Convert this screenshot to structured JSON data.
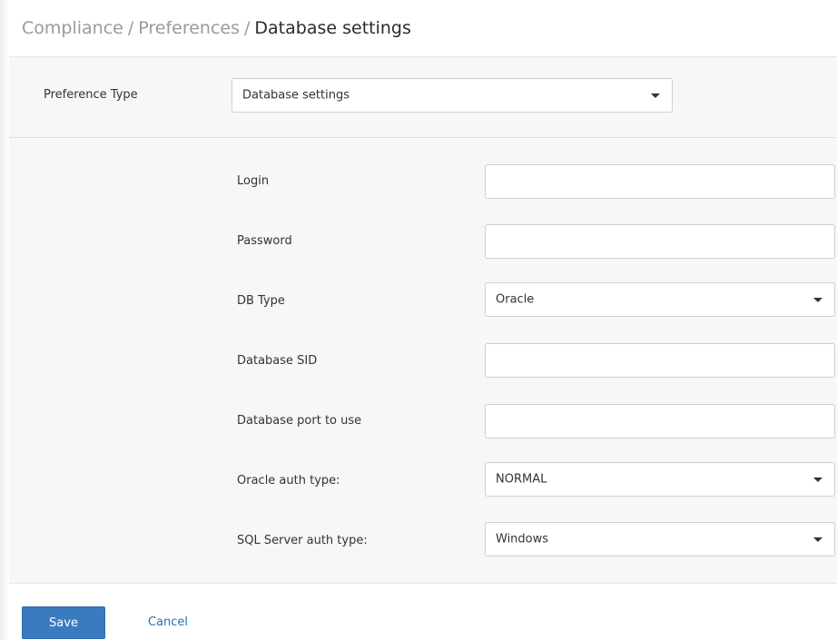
{
  "breadcrumb": {
    "items": [
      "Compliance",
      "Preferences"
    ],
    "separator": "/",
    "current": "Database settings"
  },
  "preference_type": {
    "label": "Preference Type",
    "selected": "Database settings"
  },
  "form": {
    "login": {
      "label": "Login",
      "value": ""
    },
    "password": {
      "label": "Password",
      "value": ""
    },
    "db_type": {
      "label": "DB Type",
      "selected": "Oracle"
    },
    "database_sid": {
      "label": "Database SID",
      "value": ""
    },
    "database_port": {
      "label": "Database port to use",
      "value": ""
    },
    "oracle_auth_type": {
      "label": "Oracle auth type:",
      "selected": "NORMAL"
    },
    "sql_server_auth_type": {
      "label": "SQL Server auth type:",
      "selected": "Windows"
    }
  },
  "actions": {
    "save_label": "Save",
    "cancel_label": "Cancel"
  },
  "colors": {
    "primary_button": "#3a7bbf",
    "link": "#2f6fb3",
    "panel_background": "#f7f7f7"
  },
  "icons": {
    "dropdown": "caret-down-icon"
  }
}
